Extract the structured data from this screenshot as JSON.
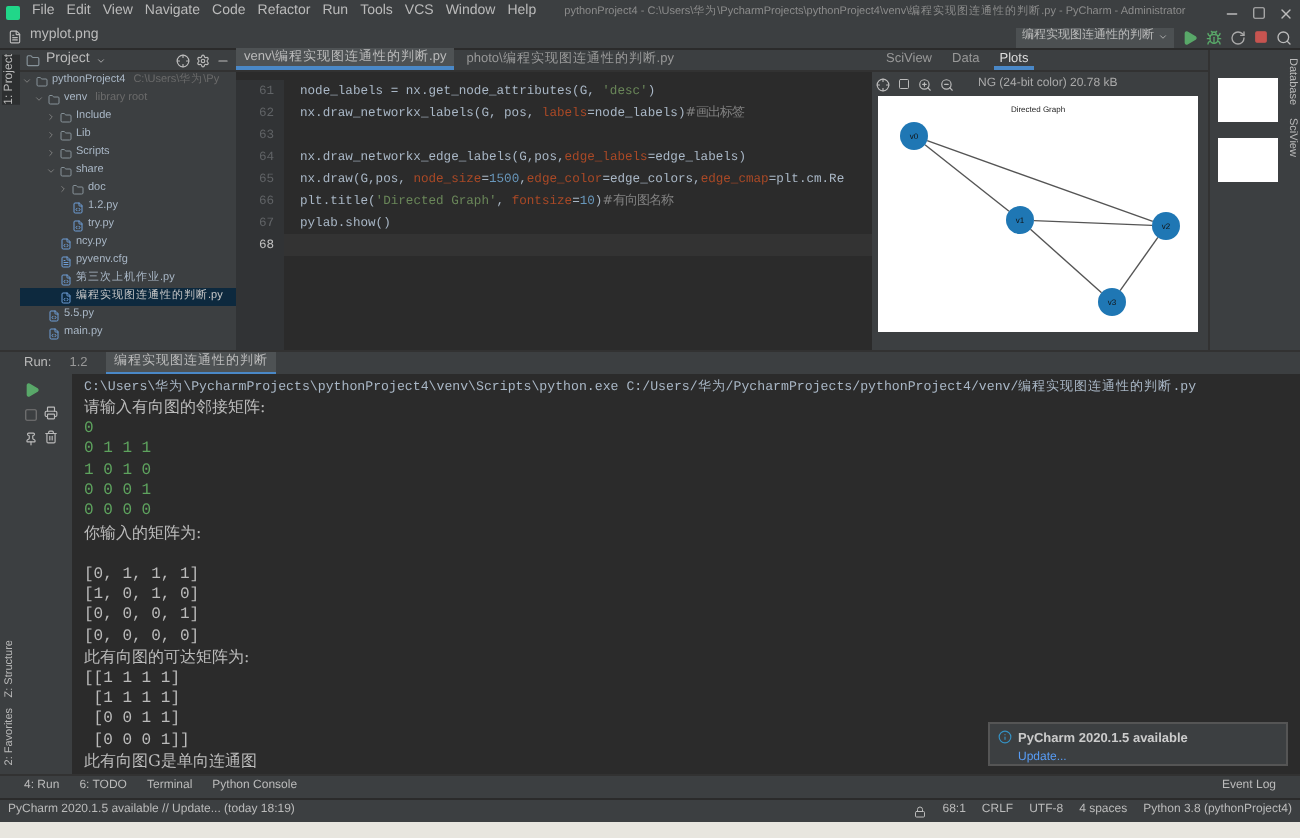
{
  "window": {
    "menu": [
      "File",
      "Edit",
      "View",
      "Navigate",
      "Code",
      "Refactor",
      "Run",
      "Tools",
      "VCS",
      "Window",
      "Help"
    ],
    "title": "pythonProject4 - C:\\Users\\华为\\PycharmProjects\\pythonProject4\\venv\\编程实现图连通性的判断.py - PyCharm - Administrator"
  },
  "navbar": {
    "breadcrumb": "myplot.png",
    "run_config": "编程实现图连通性的判断"
  },
  "left_strip": {
    "tabs": [
      "1: Project",
      "Z: Structure",
      "2: Favorites"
    ]
  },
  "project_panel": {
    "title": "Project",
    "tree": [
      {
        "label": "pythonProject4",
        "hint": "C:\\Users\\华为\\Py",
        "kind": "folder",
        "expanded": true,
        "selected": false,
        "children": [
          {
            "label": "venv",
            "hint": "library root",
            "kind": "folder",
            "expanded": true,
            "selected": false,
            "children": [
              {
                "label": "Include",
                "kind": "folder",
                "expanded": false,
                "selected": false
              },
              {
                "label": "Lib",
                "kind": "folder",
                "expanded": false,
                "selected": false
              },
              {
                "label": "Scripts",
                "kind": "folder",
                "expanded": false,
                "selected": false
              },
              {
                "label": "share",
                "kind": "folder",
                "expanded": true,
                "selected": false,
                "children": [
                  {
                    "label": "doc",
                    "kind": "folder",
                    "expanded": false,
                    "selected": false
                  },
                  {
                    "label": "1.2.py",
                    "kind": "python",
                    "selected": false
                  },
                  {
                    "label": "try.py",
                    "kind": "python",
                    "selected": false
                  }
                ]
              },
              {
                "label": "ncy.py",
                "kind": "python",
                "selected": false
              },
              {
                "label": "pyvenv.cfg",
                "kind": "config",
                "selected": false
              },
              {
                "label": "第三次上机作业.py",
                "kind": "python",
                "selected": false
              },
              {
                "label": "编程实现图连通性的判断.py",
                "kind": "python",
                "selected": true
              }
            ]
          },
          {
            "label": "5.5.py",
            "kind": "python",
            "selected": false
          },
          {
            "label": "main.py",
            "kind": "python",
            "selected": false
          }
        ]
      }
    ]
  },
  "editor": {
    "tabs": [
      {
        "label": "venv\\编程实现图连通性的判断.py",
        "selected": true
      },
      {
        "label": "photo\\编程实现图连通性的判断.py",
        "selected": false
      }
    ],
    "lines": [
      {
        "number": "61",
        "current": false,
        "parts": [
          {
            "kind": "plain",
            "text": "node_labels = nx.get_node_attributes(G, "
          },
          {
            "kind": "string",
            "text": "'desc'"
          },
          {
            "kind": "plain",
            "text": ")"
          }
        ]
      },
      {
        "number": "62",
        "current": false,
        "parts": [
          {
            "kind": "plain",
            "text": "nx.draw_networkx_labels(G, pos, "
          },
          {
            "kind": "param",
            "text": "labels"
          },
          {
            "kind": "plain",
            "text": "=node_labels)"
          },
          {
            "kind": "comment",
            "text": "#画出标签"
          }
        ]
      },
      {
        "number": "63",
        "current": false
      },
      {
        "number": "64",
        "current": false,
        "parts": [
          {
            "kind": "plain",
            "text": "nx.draw_networkx_edge_labels(G,pos,"
          },
          {
            "kind": "param",
            "text": "edge_labels"
          },
          {
            "kind": "plain",
            "text": "=edge_labels)"
          }
        ]
      },
      {
        "number": "65",
        "current": false,
        "parts": [
          {
            "kind": "plain",
            "text": "nx.draw(G,pos, "
          },
          {
            "kind": "param",
            "text": "node_size"
          },
          {
            "kind": "plain",
            "text": "="
          },
          {
            "kind": "number",
            "text": "1500"
          },
          {
            "kind": "plain",
            "text": ","
          },
          {
            "kind": "param",
            "text": "edge_color"
          },
          {
            "kind": "plain",
            "text": "=edge_colors,"
          },
          {
            "kind": "param",
            "text": "edge_cmap"
          },
          {
            "kind": "plain",
            "text": "=plt.cm.Re"
          }
        ]
      },
      {
        "number": "66",
        "current": false,
        "parts": [
          {
            "kind": "plain",
            "text": "plt.title("
          },
          {
            "kind": "string",
            "text": "'Directed Graph'"
          },
          {
            "kind": "plain",
            "text": ", "
          },
          {
            "kind": "param",
            "text": "fontsize"
          },
          {
            "kind": "plain",
            "text": "="
          },
          {
            "kind": "number",
            "text": "10"
          },
          {
            "kind": "plain",
            "text": ")"
          },
          {
            "kind": "comment",
            "text": "#有向图名称"
          }
        ]
      },
      {
        "number": "67",
        "current": false,
        "parts": [
          {
            "kind": "plain",
            "text": "pylab.show()"
          }
        ]
      },
      {
        "number": "68",
        "current": true
      }
    ]
  },
  "sciview": {
    "tabs": [
      {
        "label": "SciView",
        "selected": false
      },
      {
        "label": "Data",
        "selected": false
      },
      {
        "label": "Plots",
        "selected": true
      }
    ],
    "image_info": "NG (24-bit color) 20.78 kB",
    "plot": {
      "title": "Directed Graph",
      "nodes": [
        "v0",
        "v1",
        "v2",
        "v3"
      ]
    }
  },
  "right_strip": {
    "tabs": [
      "Database",
      "SciView"
    ]
  },
  "run_panel": {
    "label": "Run:",
    "tabs": [
      {
        "label": "1.2",
        "selected": false
      },
      {
        "label": "编程实现图连通性的判断",
        "selected": true
      }
    ],
    "lines": [
      {
        "kind": "path",
        "gap_before": false,
        "text": "C:\\Users\\华为\\PycharmProjects\\pythonProject4\\venv\\Scripts\\python.exe C:/Users/华为/PycharmProjects/pythonProject4/venv/编程实现图连通性的判断.py"
      },
      {
        "kind": "output",
        "gap_before": false,
        "text": "请输入有向图的邻接矩阵:"
      },
      {
        "kind": "input",
        "gap_before": false,
        "text": "0"
      },
      {
        "kind": "input",
        "gap_before": false,
        "text": "0 1 1 1"
      },
      {
        "kind": "input",
        "gap_before": false,
        "text": "1 0 1 0"
      },
      {
        "kind": "input",
        "gap_before": false,
        "text": "0 0 0 1"
      },
      {
        "kind": "input",
        "gap_before": false,
        "text": "0 0 0 0"
      },
      {
        "kind": "output",
        "gap_before": false,
        "text": "你输入的矩阵为:"
      },
      {
        "kind": "output",
        "gap_before": true,
        "text": "[0, 1, 1, 1]"
      },
      {
        "kind": "output",
        "gap_before": false,
        "text": "[1, 0, 1, 0]"
      },
      {
        "kind": "output",
        "gap_before": false,
        "text": "[0, 0, 0, 1]"
      },
      {
        "kind": "output",
        "gap_before": false,
        "text": "[0, 0, 0, 0]"
      },
      {
        "kind": "output",
        "gap_before": false,
        "text": "此有向图的可达矩阵为:"
      },
      {
        "kind": "output",
        "gap_before": false,
        "text": "[[1 1 1 1]"
      },
      {
        "kind": "output",
        "gap_before": false,
        "text": " [1 1 1 1]"
      },
      {
        "kind": "output",
        "gap_before": false,
        "text": " [0 0 1 1]"
      },
      {
        "kind": "output",
        "gap_before": false,
        "text": " [0 0 0 1]]"
      },
      {
        "kind": "output",
        "gap_before": false,
        "text": "此有向图G是单向连通图"
      }
    ]
  },
  "notification": {
    "title": "PyCharm 2020.1.5 available",
    "link": "Update..."
  },
  "bottom_tabs": [
    "4: Run",
    "6: TODO",
    "Terminal",
    "Python Console"
  ],
  "event_log": "Event Log",
  "status_bar": {
    "message": "PyCharm 2020.1.5 available // Update... (today 18:19)",
    "items": [
      "68:1",
      "CRLF",
      "UTF-8",
      "4 spaces",
      "Python 3.8 (pythonProject4)"
    ]
  }
}
